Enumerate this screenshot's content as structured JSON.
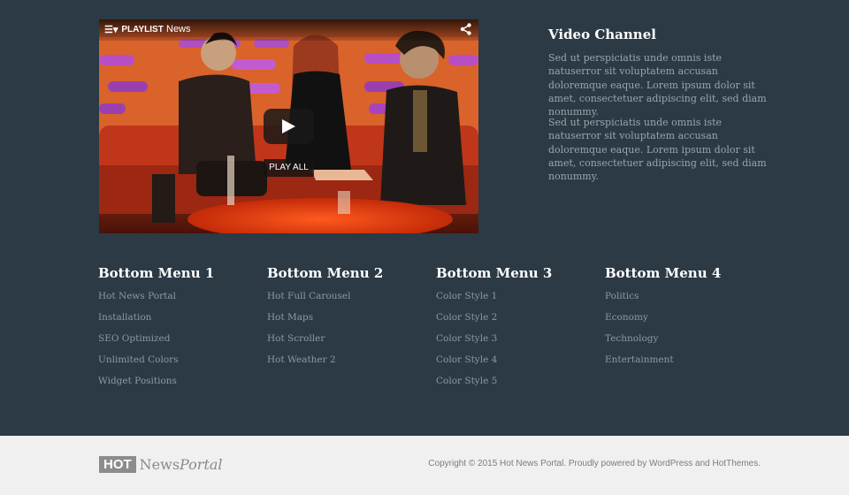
{
  "video": {
    "playlist_label": "PLAYLIST",
    "title": "News",
    "play_all_label": "PLAY ALL"
  },
  "channel": {
    "title": "Video Channel",
    "paragraphs": [
      "Sed ut perspiciatis unde omnis iste natuserror sit voluptatem accusan doloremque eaque. Lorem ipsum dolor sit amet, consectetuer adipiscing elit, sed diam nonummy.",
      "Sed ut perspiciatis unde omnis iste natuserror sit voluptatem accusan doloremque eaque. Lorem ipsum dolor sit amet, consectetuer adipiscing elit, sed diam nonummy."
    ]
  },
  "menus": [
    {
      "title": "Bottom Menu 1",
      "items": [
        "Hot News Portal",
        "Installation",
        "SEO Optimized",
        "Unlimited Colors",
        "Widget Positions"
      ]
    },
    {
      "title": "Bottom Menu 2",
      "items": [
        "Hot Full Carousel",
        "Hot Maps",
        "Hot Scroller",
        "Hot Weather 2"
      ]
    },
    {
      "title": "Bottom Menu 3",
      "items": [
        "Color Style 1",
        "Color Style 2",
        "Color Style 3",
        "Color Style 4",
        "Color Style 5"
      ]
    },
    {
      "title": "Bottom Menu 4",
      "items": [
        "Politics",
        "Economy",
        "Technology",
        "Entertainment"
      ]
    }
  ],
  "footer": {
    "logo_hot": "HOT",
    "logo_news": "News",
    "logo_portal": "Portal",
    "copyright": "Copyright © 2015 Hot News Portal. Proudly powered by WordPress and HotThemes."
  },
  "colors": {
    "background": "#2c3a45",
    "footer_bg": "#f0f0f0",
    "menu_link": "#8d98a1"
  }
}
